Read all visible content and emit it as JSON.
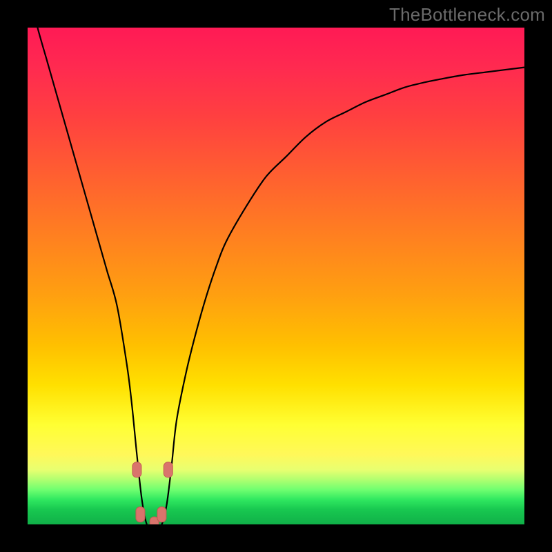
{
  "watermark": "TheBottleneck.com",
  "colors": {
    "frame": "#000000",
    "curve_stroke": "#000000",
    "marker_fill": "#d9746c",
    "marker_stroke": "#c25a52"
  },
  "chart_data": {
    "type": "line",
    "title": "",
    "xlabel": "",
    "ylabel": "",
    "xlim": [
      0,
      100
    ],
    "ylim": [
      0,
      100
    ],
    "grid": false,
    "legend": false,
    "x": [
      0,
      2,
      4,
      6,
      8,
      10,
      12,
      14,
      16,
      18,
      20,
      21,
      22,
      23,
      24,
      25,
      26,
      27,
      28,
      29,
      30,
      32,
      34,
      36,
      38,
      40,
      44,
      48,
      52,
      56,
      60,
      64,
      68,
      72,
      76,
      80,
      84,
      88,
      92,
      96,
      100
    ],
    "y": [
      108,
      100,
      93,
      86,
      79,
      72,
      65,
      58,
      51,
      44,
      32,
      24,
      14,
      5,
      0,
      0,
      0,
      0,
      4,
      12,
      21,
      31,
      39,
      46,
      52,
      57,
      64,
      70,
      74,
      78,
      81,
      83,
      85,
      86.5,
      88,
      89,
      89.8,
      90.5,
      91,
      91.5,
      92
    ],
    "markers": [
      {
        "x": 22.0,
        "y": 11
      },
      {
        "x": 22.7,
        "y": 2
      },
      {
        "x": 25.5,
        "y": 0
      },
      {
        "x": 27.0,
        "y": 2
      },
      {
        "x": 28.3,
        "y": 11
      }
    ]
  }
}
